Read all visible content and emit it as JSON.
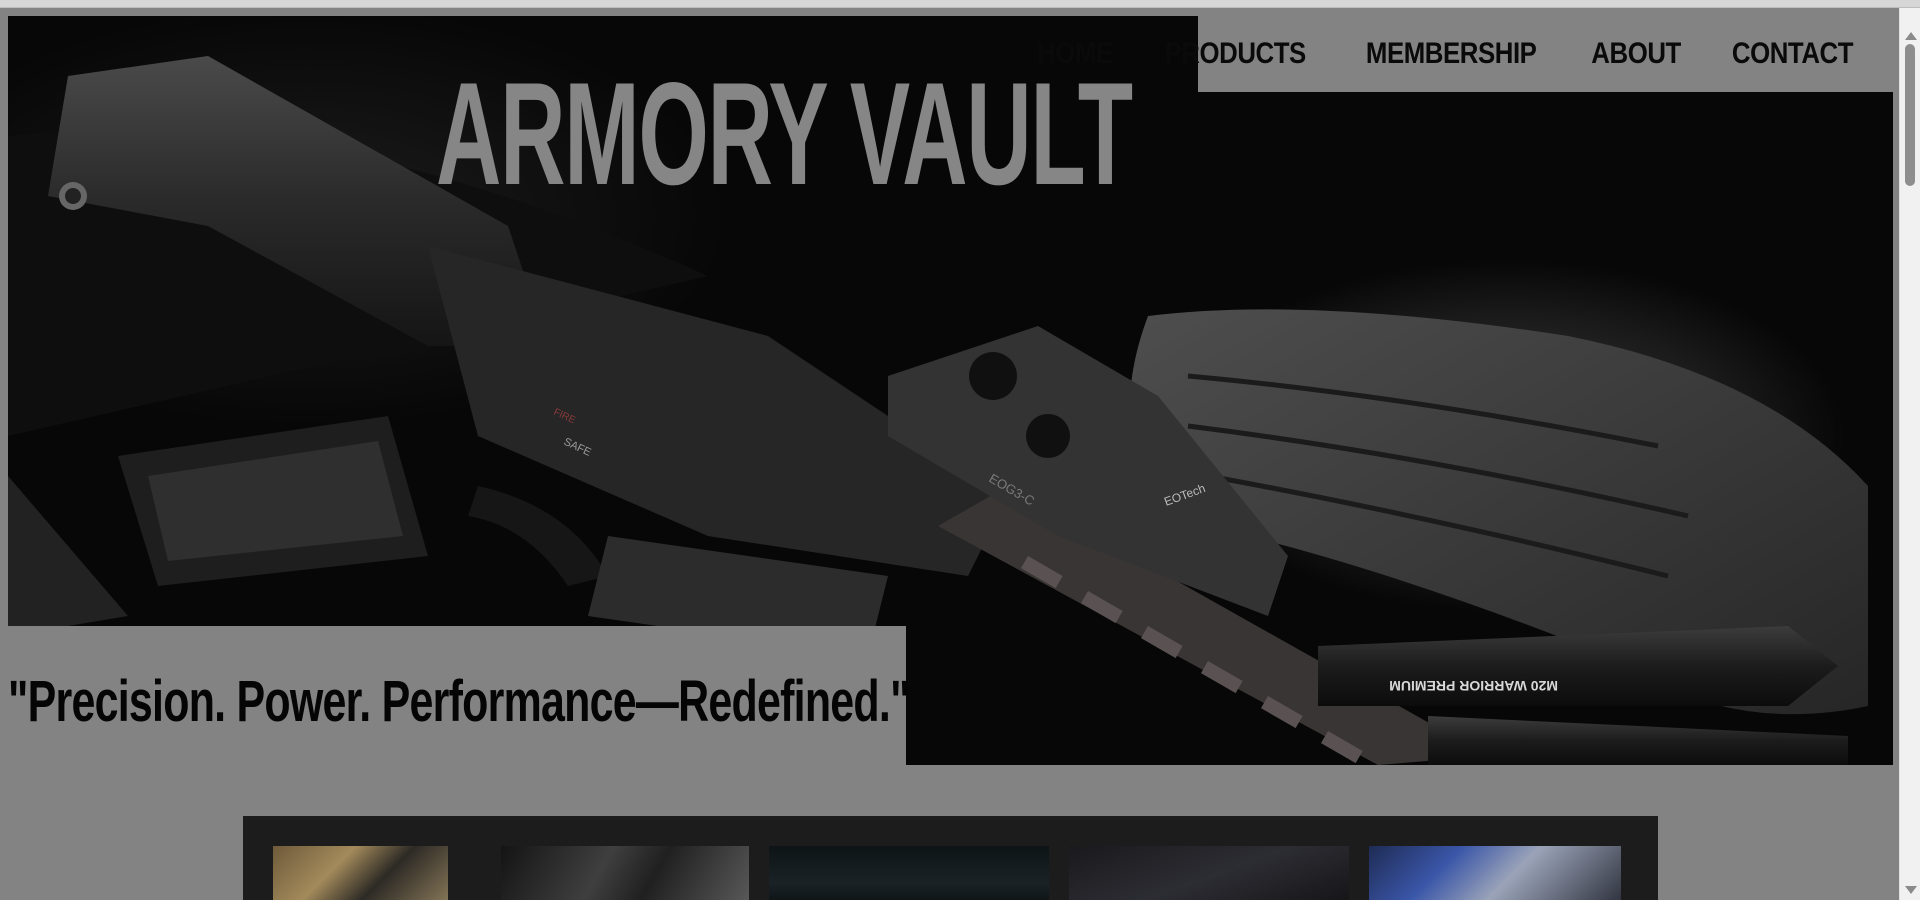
{
  "site": {
    "brand": "ARMORY VAULT",
    "tagline": "\"Precision. Power. Performance—Redefined.\""
  },
  "nav": {
    "items": [
      "HOME",
      "PRODUCTS",
      "MEMBERSHIP",
      "ABOUT",
      "CONTACT"
    ]
  },
  "hero": {
    "image": "tactical-rifle-flashlight-gloves-photo",
    "engravings": {
      "safe": "SAFE",
      "fire": "FIRE",
      "optic_model": "EOG3-C",
      "optic_brand": "EOTech",
      "flashlight": "M20 WARRIOR PREMIUM"
    }
  },
  "gallery": {
    "thumbnails": [
      "cash-stack-thumbnail",
      "rifle-closeup-thumbnail",
      "dark-scene-thumbnail",
      "jacket-thumbnail",
      "optics-parts-thumbnail"
    ]
  },
  "colors": {
    "background": "#838383",
    "nav_text": "#0a0a0a",
    "brand_text": "#868686",
    "gallery_bg": "#1c1c1c"
  }
}
